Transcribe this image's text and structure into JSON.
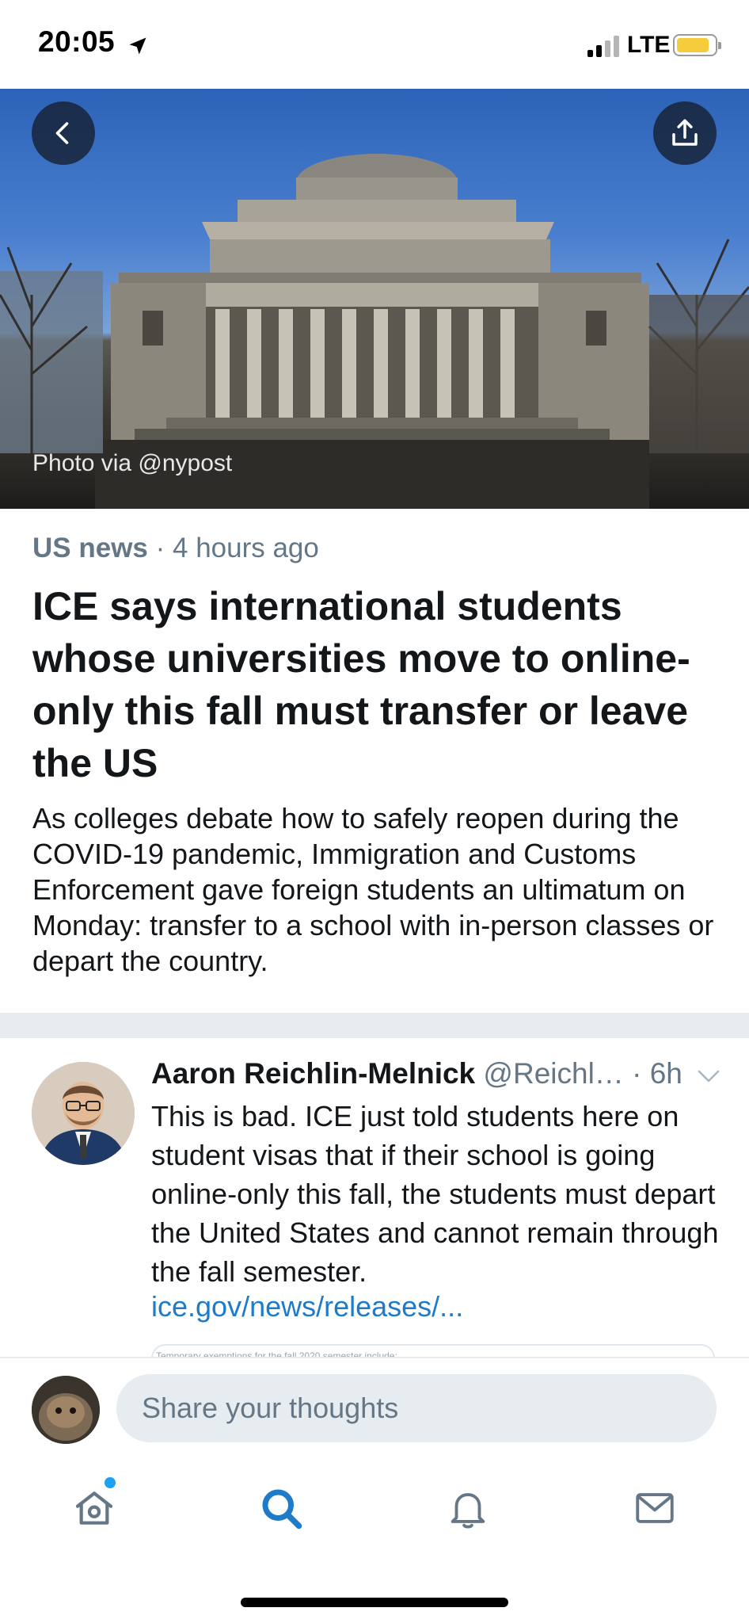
{
  "status_bar": {
    "time": "20:05",
    "network": "LTE"
  },
  "hero": {
    "photo_credit": "Photo via @nypost"
  },
  "article": {
    "category": "US news",
    "separator": " · ",
    "time_ago": "4 hours ago",
    "headline": "ICE says international students whose universities move to online-only this fall must transfer or leave the US",
    "summary": "As colleges debate how to safely reopen during the COVID-19 pandemic, Immigration and Customs Enforcement gave foreign students an ultimatum on Monday: transfer to a school with in-person classes or depart the country."
  },
  "tweet": {
    "name": "Aaron Reichlin-Melnick",
    "handle": "@Reichl…",
    "time": "· 6h",
    "text": "This is bad. ICE just told students here on student visas that if their school is going online-only this fall, the students must depart the United States and cannot remain through the fall semester.",
    "link": "ice.gov/news/releases/...",
    "card_peek_text": "Temporary exemptions for the fall 2020 semester include:"
  },
  "compose": {
    "placeholder": "Share your thoughts"
  },
  "tabs": [
    {
      "icon": "home-icon",
      "has_notification_dot": true
    },
    {
      "icon": "search-icon",
      "active": true
    },
    {
      "icon": "bell-icon"
    },
    {
      "icon": "mail-icon"
    }
  ],
  "colors": {
    "accent": "#1da1f2",
    "link": "#1d7bc9",
    "active_tab": "#1d7bc9",
    "secondary_text": "#657786",
    "divider": "#e6ecf0",
    "battery": "#f4cc3c"
  }
}
